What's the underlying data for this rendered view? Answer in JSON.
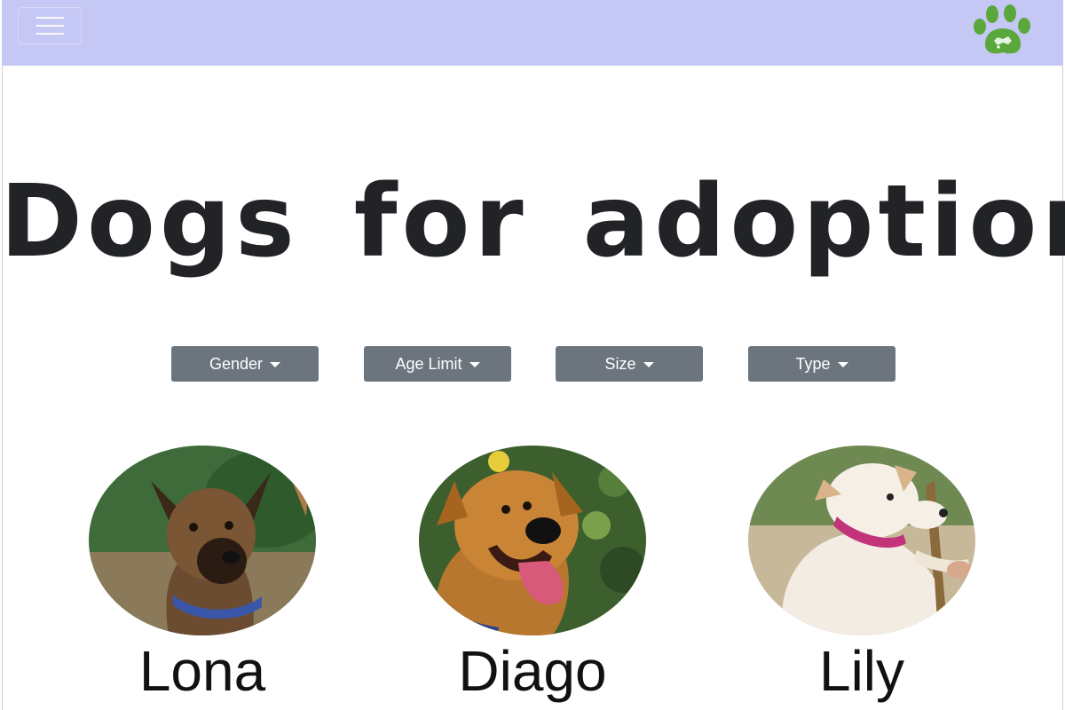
{
  "header": {
    "menu_icon": "hamburger-menu-icon",
    "logo_icon": "paw-print-logo-icon",
    "colors": {
      "navbar": "#c5c7f5",
      "logo_green": "#5aa83c"
    }
  },
  "main": {
    "title": "Dogs for adoption",
    "filters": [
      {
        "label": "Gender"
      },
      {
        "label": "Age Limit"
      },
      {
        "label": "Size"
      },
      {
        "label": "Type"
      }
    ],
    "dogs": [
      {
        "name": "Lona"
      },
      {
        "name": "Diago"
      },
      {
        "name": "Lily"
      }
    ]
  }
}
